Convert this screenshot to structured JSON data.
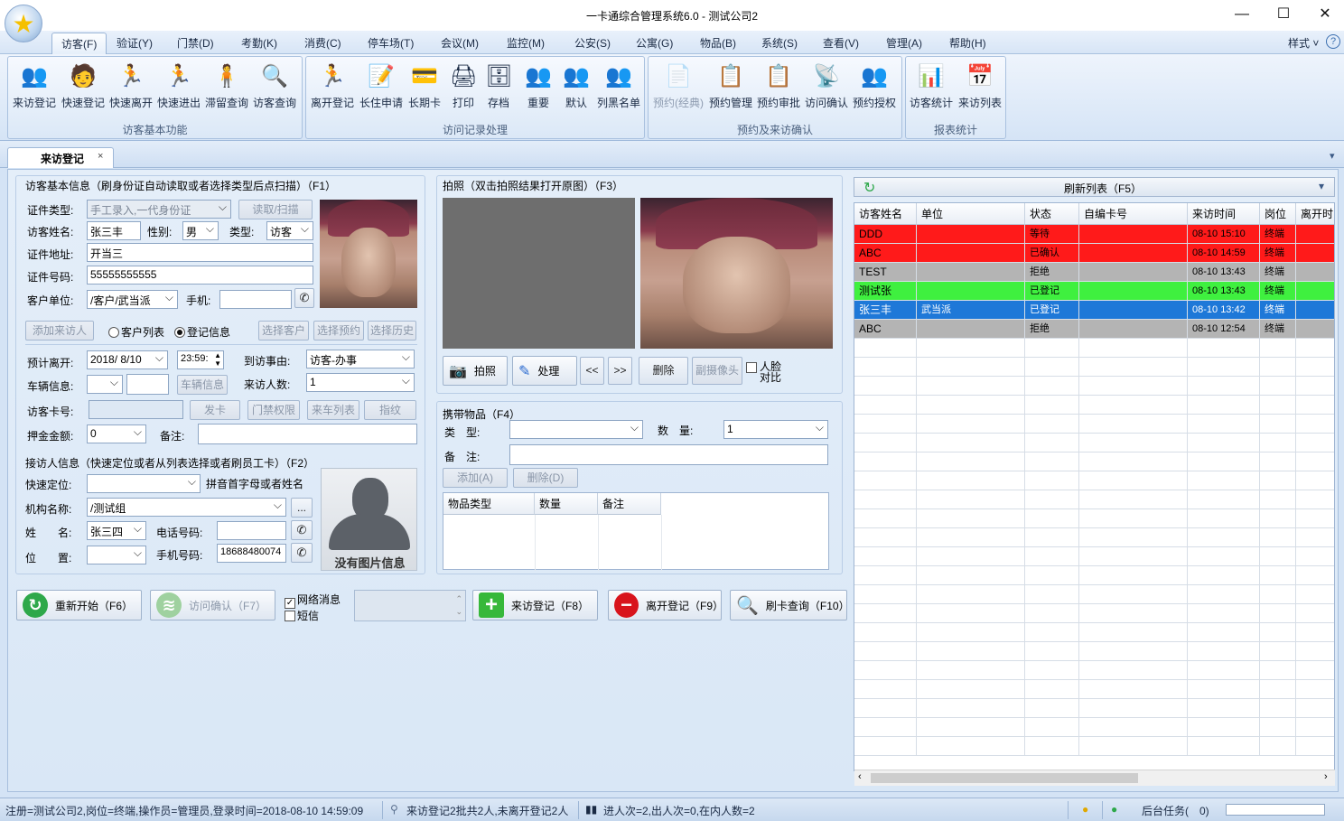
{
  "window": {
    "title": "一卡通综合管理系统6.0 - 测试公司2",
    "minimize_glyph": "—",
    "maximize_glyph": "☐",
    "close_glyph": "✕"
  },
  "menu": {
    "items": [
      "访客(F)",
      "验证(Y)",
      "门禁(D)",
      "考勤(K)",
      "消费(C)",
      "停车场(T)",
      "会议(M)",
      "监控(M)",
      "公安(S)",
      "公寓(G)",
      "物品(B)",
      "系统(S)",
      "查看(V)",
      "管理(A)",
      "帮助(H)"
    ],
    "style_label": "样式",
    "style_arrow": "˅",
    "help_glyph": "?"
  },
  "ribbon": {
    "groups": [
      {
        "title": "访客基本功能",
        "buttons": [
          {
            "label": "来访登记",
            "icon": "visitor-register-icon",
            "glyph": "👥"
          },
          {
            "label": "快速登记",
            "icon": "quick-register-icon",
            "glyph": "🧑"
          },
          {
            "label": "快速离开",
            "icon": "quick-leave-icon",
            "glyph": "🏃"
          },
          {
            "label": "快速进出",
            "icon": "quick-inout-icon",
            "glyph": "🏃"
          },
          {
            "label": "滞留查询",
            "icon": "stay-query-icon",
            "glyph": "🧍"
          },
          {
            "label": "访客查询",
            "icon": "visitor-query-icon",
            "glyph": "🔍"
          }
        ]
      },
      {
        "title": "访问记录处理",
        "buttons": [
          {
            "label": "离开登记",
            "icon": "leave-register-icon",
            "glyph": "🏃"
          },
          {
            "label": "长住申请",
            "icon": "long-stay-apply-icon",
            "glyph": "📝"
          },
          {
            "label": "长期卡",
            "icon": "long-term-card-icon",
            "glyph": "💳"
          },
          {
            "label": "打印",
            "icon": "print-icon",
            "glyph": "🖨"
          },
          {
            "label": "存档",
            "icon": "archive-icon",
            "glyph": "🗄"
          },
          {
            "label": "重要",
            "icon": "important-icon",
            "glyph": "👥"
          },
          {
            "label": "默认",
            "icon": "default-icon",
            "glyph": "👥"
          },
          {
            "label": "列黑名单",
            "icon": "blacklist-icon",
            "glyph": "👥"
          }
        ]
      },
      {
        "title": "预约及来访确认",
        "buttons": [
          {
            "label": "预约(经典)",
            "icon": "reservation-classic-icon",
            "glyph": "📄",
            "disabled": true
          },
          {
            "label": "预约管理",
            "icon": "reservation-manage-icon",
            "glyph": "📋"
          },
          {
            "label": "预约审批",
            "icon": "reservation-approve-icon",
            "glyph": "📋"
          },
          {
            "label": "访问确认",
            "icon": "visit-confirm-icon",
            "glyph": "📡"
          },
          {
            "label": "预约授权",
            "icon": "reservation-auth-icon",
            "glyph": "👥"
          }
        ]
      },
      {
        "title": "报表统计",
        "buttons": [
          {
            "label": "访客统计",
            "icon": "visitor-stats-icon",
            "glyph": "📊"
          },
          {
            "label": "来访列表",
            "icon": "visit-list-icon",
            "glyph": "📅"
          }
        ]
      }
    ]
  },
  "tab": {
    "label": "来访登记",
    "close": "×",
    "overflow_glyph": "▾"
  },
  "basic_info": {
    "header": "访客基本信息（刷身份证自动读取或者选择类型后点扫描）（F1）",
    "id_type_label": "证件类型:",
    "id_type_value": "手工录入,一代身份证",
    "read_scan_button": "读取/扫描",
    "name_label": "访客姓名:",
    "name_value": "张三丰",
    "gender_label": "性别:",
    "gender_value": "男",
    "type_label": "类型:",
    "type_value": "访客",
    "address_label": "证件地址:",
    "address_value": "开当三",
    "id_no_label": "证件号码:",
    "id_no_value": "55555555555",
    "company_label": "客户单位:",
    "company_value": "/客户/武当派",
    "mobile_label": "手机:",
    "mobile_value": "",
    "add_visitor_button": "添加来访人",
    "radio_customer_list": "客户列表",
    "radio_register_info": "登记信息",
    "select_customer_button": "选择客户",
    "select_reservation_button": "选择预约",
    "select_history_button": "选择历史"
  },
  "visit_info": {
    "leave_label": "预计离开:",
    "leave_date": "2018/ 8/10",
    "leave_time": "23:59:",
    "reason_label": "到访事由:",
    "reason_value": "访客-办事",
    "vehicle_label": "车辆信息:",
    "vehicle_button": "车辆信息",
    "visitors_count_label": "来访人数:",
    "visitors_count_value": "1",
    "card_no_label": "访客卡号:",
    "issue_card_button": "发卡",
    "door_rights_button": "门禁权限",
    "vehicle_list_button": "来车列表",
    "fingerprint_button": "指纹",
    "deposit_label": "押金金额:",
    "deposit_value": "0",
    "remark_label": "备注:"
  },
  "host_info": {
    "header": "接访人信息（快速定位或者从列表选择或者刷员工卡）（F2）",
    "locate_label": "快速定位:",
    "locate_hint": "拼音首字母或者姓名",
    "org_label": "机构名称:",
    "org_value": "/测试组",
    "org_more": "...",
    "name_label": "姓　　名:",
    "name_value": "张三四",
    "phone_label": "电话号码:",
    "position_label": "位　　置:",
    "mobile_label": "手机号码:",
    "mobile_value": "18688480074",
    "no_photo_text": "没有图片信息"
  },
  "photo": {
    "header": "拍照（双击拍照结果打开原图）（F3）",
    "capture_button": "拍照",
    "process_button": "处理",
    "prev_button": "<<",
    "next_button": ">>",
    "delete_button": "删除",
    "sub_camera_button": "副摄像头",
    "face_compare_label": "人脸对比"
  },
  "items": {
    "header": "携带物品（F4）",
    "type_label": "类　型:",
    "qty_label": "数　量:",
    "qty_value": "1",
    "remark_label": "备　注:",
    "add_button": "添加(A)",
    "delete_button": "删除(D)",
    "columns": [
      "物品类型",
      "数量",
      "备注"
    ]
  },
  "actions": {
    "restart": "重新开始（F6）",
    "visit_confirm": "访问确认（F7）",
    "net_message": "网络消息",
    "sms": "短信",
    "register": "来访登记（F8）",
    "leave": "离开登记（F9）",
    "card_query": "刷卡查询（F10）"
  },
  "list": {
    "refresh_label": "刷新列表（F5）",
    "columns": [
      "访客姓名",
      "单位",
      "状态",
      "自编卡号",
      "来访时间",
      "岗位",
      "离开时"
    ],
    "rows": [
      {
        "name": "DDD",
        "unit": "",
        "status": "等待",
        "card": "",
        "time": "08-10 15:10",
        "post": "终端",
        "color": "#ff1a1a"
      },
      {
        "name": "ABC",
        "unit": "",
        "status": "已确认",
        "card": "",
        "time": "08-10 14:59",
        "post": "终端",
        "color": "#ff1a1a"
      },
      {
        "name": "TEST",
        "unit": "",
        "status": "拒绝",
        "card": "",
        "time": "08-10 13:43",
        "post": "终端",
        "color": "#b4b4b4"
      },
      {
        "name": "测试张",
        "unit": "",
        "status": "已登记",
        "card": "",
        "time": "08-10 13:43",
        "post": "终端",
        "color": "#3ff03f"
      },
      {
        "name": "张三丰",
        "unit": "武当派",
        "status": "已登记",
        "card": "",
        "time": "08-10 13:42",
        "post": "终端",
        "color": "#1e78d8"
      },
      {
        "name": "ABC",
        "unit": "",
        "status": "拒绝",
        "card": "",
        "time": "08-10 12:54",
        "post": "终端",
        "color": "#b4b4b4"
      }
    ]
  },
  "status": {
    "login": "注册=测试公司2,岗位=终端,操作员=管理员,登录时间=2018-08-10 14:59:09",
    "visit_summary": "来访登记2批共2人,未离开登记2人",
    "inout_summary": "进人次=2,出人次=0,在内人数=2",
    "background_tasks": "后台任务(　0)"
  }
}
